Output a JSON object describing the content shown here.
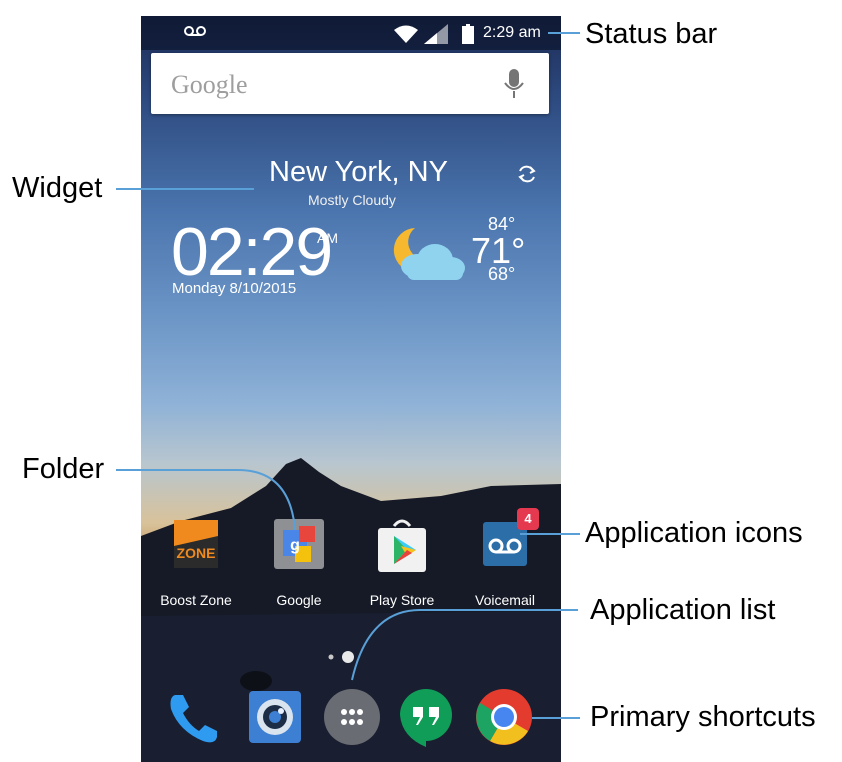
{
  "status_bar": {
    "time": "2:29 am"
  },
  "search": {
    "logo": "Google"
  },
  "weather": {
    "city": "New York, NY",
    "condition": "Mostly Cloudy",
    "time": "02:29",
    "ampm": "AM",
    "date": "Monday  8/10/2015",
    "high": "84°",
    "current": "71°",
    "low": "68°"
  },
  "apps": [
    {
      "label": "Boost Zone",
      "icon": "boost-zone-icon"
    },
    {
      "label": "Google",
      "icon": "google-folder-icon"
    },
    {
      "label": "Play Store",
      "icon": "play-store-icon"
    },
    {
      "label": "Voicemail",
      "icon": "voicemail-icon",
      "badge": "4"
    }
  ],
  "dock": [
    {
      "icon": "phone-icon"
    },
    {
      "icon": "camera-icon"
    },
    {
      "icon": "app-drawer-icon"
    },
    {
      "icon": "hangouts-icon"
    },
    {
      "icon": "chrome-icon"
    }
  ],
  "callouts": {
    "status_bar": "Status bar",
    "widget": "Widget",
    "folder": "Folder",
    "application_icons": "Application icons",
    "application_list": "Application list",
    "primary_shortcuts": "Primary shortcuts"
  },
  "colors": {
    "callout_line": "#5aa0d8",
    "badge": "#e53950",
    "play_store": "#f1f1f1"
  }
}
